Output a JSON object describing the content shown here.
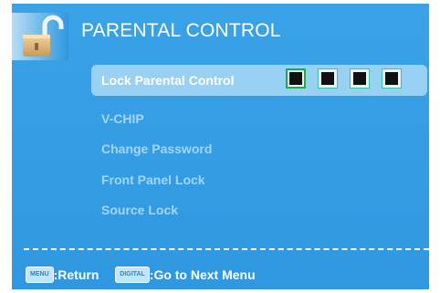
{
  "header": {
    "title": "PARENTAL CONTROL",
    "icon": "padlock-open-icon"
  },
  "menu": {
    "items": [
      {
        "label": "Lock Parental Control",
        "selected": true
      },
      {
        "label": "V-CHIP",
        "selected": false
      },
      {
        "label": "Change Password",
        "selected": false
      },
      {
        "label": "Front Panel Lock",
        "selected": false
      },
      {
        "label": "Source Lock",
        "selected": false
      }
    ],
    "pin_slots": 4,
    "pin_active_index": 0
  },
  "footer": {
    "menu_key": "MENU",
    "menu_hint": ":Return",
    "digital_key": "DIGITAL",
    "digital_hint": ":Go to Next Menu"
  },
  "colors": {
    "background": "#3aa2e6",
    "selected_row": "#98d1f4",
    "inactive_text": "#a3d6f6",
    "active_pin_border": "#14b046"
  }
}
